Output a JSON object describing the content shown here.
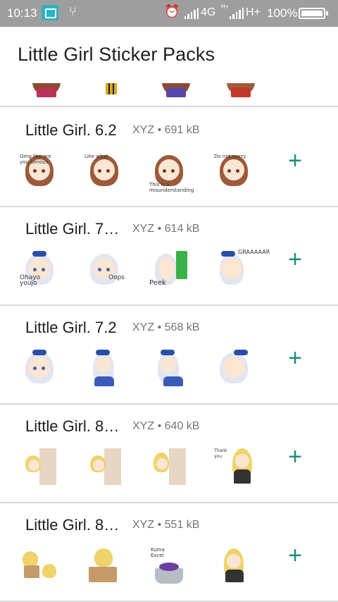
{
  "status_bar": {
    "time": "10:13",
    "network": "4G",
    "network_sub": "H+",
    "network2": "H+",
    "battery": "100%"
  },
  "app": {
    "title": "Little Girl Sticker Packs"
  },
  "colors": {
    "accent": "#1b8f7a",
    "status_bar": "#9e9e9e",
    "divider": "#d8d8d8"
  },
  "packs": [
    {
      "name": "Little Girl. 6.2",
      "publisher": "XYZ",
      "separator": "•",
      "size": "691 kB",
      "style": "brown"
    },
    {
      "name": "Little Girl. 7…",
      "publisher": "XYZ",
      "separator": "•",
      "size": "614 kB",
      "style": "silver"
    },
    {
      "name": "Little Girl. 7.2",
      "publisher": "XYZ",
      "separator": "•",
      "size": "568 kB",
      "style": "silver"
    },
    {
      "name": "Little Girl. 8…",
      "publisher": "XYZ",
      "separator": "•",
      "size": "640 kB",
      "style": "blonde-door"
    },
    {
      "name": "Little Girl. 8…",
      "publisher": "XYZ",
      "separator": "•",
      "size": "551 kB",
      "style": "blonde"
    }
  ],
  "sticker_captions": {
    "pack0": [
      "Omg like are you serious",
      "Like what",
      "This is a misunderstanding",
      "Do not worry"
    ],
    "pack1": [
      "Ohayo youjo",
      "Oops",
      "Peek",
      "GRAAAAAR"
    ],
    "pack3": [
      "",
      "",
      "",
      "Thank you"
    ],
    "pack4": [
      "",
      "",
      "Kuma Excel",
      ""
    ]
  },
  "add_button": {
    "label": "+"
  }
}
